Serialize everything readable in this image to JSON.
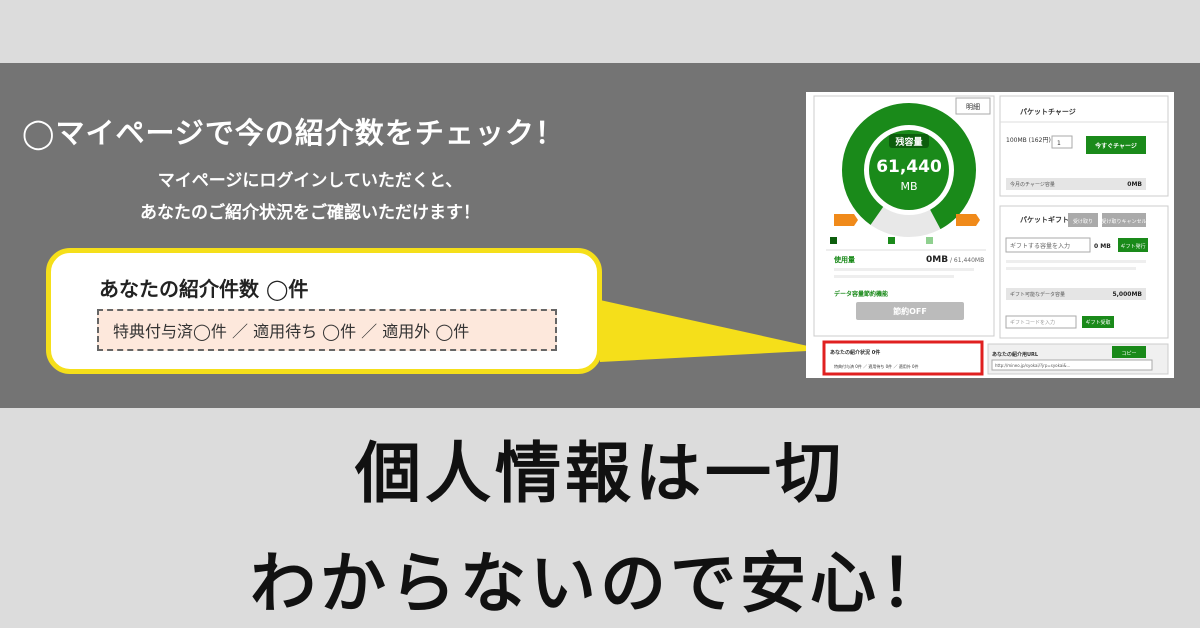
{
  "heading": "◯マイページで今の紹介数をチェック！",
  "subtext": {
    "line1": "マイページにログインしていただくと、",
    "line2": "あなたのご紹介状況をご確認いただけます！"
  },
  "callout": {
    "title": "あなたの紹介件数 ◯件",
    "detail": "特典付与済◯件 ／ 適用待ち ◯件 ／ 適用外 ◯件"
  },
  "screenshot": {
    "remaining_label": "残容量",
    "remaining_value": "61,440",
    "remaining_unit": "MB",
    "spec_label": "明細",
    "used_label": "使用量",
    "used_value": "0MB",
    "used_total": "/ 61,440MB",
    "switch_label": "データ容量節約機能",
    "switch_button": "節約OFF",
    "switch_brand": "mineoスイッチ",
    "charge_title": "パケットチャージ",
    "charge_item": "100MB (162円)",
    "charge_qty": "1",
    "charge_button": "今すぐチャージ",
    "charge_row_label": "今月のチャージ容量",
    "charge_row_value": "0MB",
    "gift_title": "パケットギフト",
    "gift_tab1": "受け取り",
    "gift_tab2": "受け取りキャンセル",
    "gift_input": "ギフトする容量を入力",
    "gift_mb": "0 MB",
    "gift_button": "ギフト発行",
    "gift_row_label": "ギフト可能なデータ容量",
    "gift_row_value": "5,000MB",
    "gift_code_placeholder": "ギフトコードを入力",
    "gift_code_button": "ギフト受取",
    "referral_label": "あなたの紹介状況 0件",
    "referral_detail": "特典付与済 0件 ／ 適用待ち 0件 ／ 適用外 0件",
    "url_label": "あなたの紹介用URL",
    "copy_button": "コピー",
    "url_value": "http://mineo.jp/syokai/?jrp=syokai&..."
  },
  "bottom": {
    "line1": "個人情報は一切",
    "line2": "わからないので安心！"
  },
  "colors": {
    "panel": "#747474",
    "callout_border": "#f5df1a",
    "green": "#1a8a1a",
    "highlight": "#e02020"
  }
}
